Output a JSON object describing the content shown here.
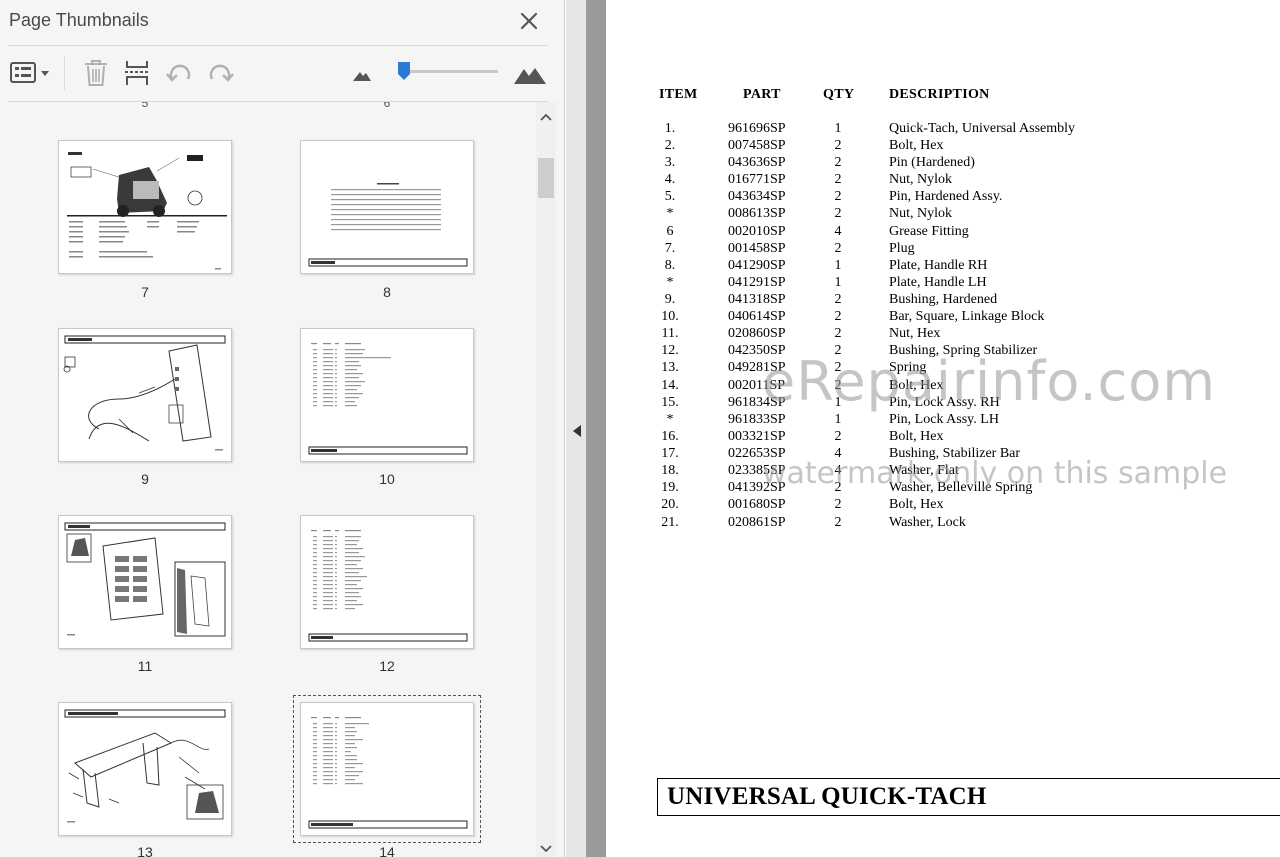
{
  "panel": {
    "title": "Page Thumbnails",
    "toolbar": {
      "icons": [
        "options-menu-icon",
        "trash-icon",
        "extract-pages-icon",
        "rotate-counterclockwise-icon",
        "rotate-clockwise-icon",
        "small-mountain-icon",
        "large-mountain-icon"
      ],
      "thumbnail_size_level": 0.05
    },
    "partial_labels": [
      "5",
      "6"
    ],
    "thumbnails": [
      {
        "page": "7"
      },
      {
        "page": "8"
      },
      {
        "page": "9"
      },
      {
        "page": "10"
      },
      {
        "page": "11"
      },
      {
        "page": "12"
      },
      {
        "page": "13"
      },
      {
        "page": "14",
        "selected": true
      }
    ]
  },
  "document": {
    "headers": {
      "item": "ITEM",
      "part": "PART",
      "qty": "QTY",
      "description": "DESCRIPTION"
    },
    "rows": [
      {
        "item": "1.",
        "part": "961696SP",
        "qty": "1",
        "desc": "Quick-Tach, Universal Assembly"
      },
      {
        "item": "2.",
        "part": "007458SP",
        "qty": "2",
        "desc": "Bolt, Hex"
      },
      {
        "item": "3.",
        "part": "043636SP",
        "qty": "2",
        "desc": "Pin (Hardened)"
      },
      {
        "item": "4.",
        "part": "016771SP",
        "qty": "2",
        "desc": "Nut, Nylok"
      },
      {
        "item": "5.",
        "part": "043634SP",
        "qty": "2",
        "desc": "Pin, Hardened Assy."
      },
      {
        "item": "*",
        "part": "008613SP",
        "qty": "2",
        "desc": "Nut, Nylok"
      },
      {
        "item": "6",
        "part": "002010SP",
        "qty": "4",
        "desc": "Grease Fitting"
      },
      {
        "item": "7.",
        "part": "001458SP",
        "qty": "2",
        "desc": "Plug"
      },
      {
        "item": "8.",
        "part": "041290SP",
        "qty": "1",
        "desc": "Plate, Handle RH"
      },
      {
        "item": "*",
        "part": "041291SP",
        "qty": "1",
        "desc": "Plate, Handle LH"
      },
      {
        "item": "9.",
        "part": "041318SP",
        "qty": "2",
        "desc": "Bushing, Hardened"
      },
      {
        "item": "10.",
        "part": "040614SP",
        "qty": "2",
        "desc": "Bar, Square, Linkage Block"
      },
      {
        "item": "11.",
        "part": "020860SP",
        "qty": "2",
        "desc": "Nut, Hex"
      },
      {
        "item": "12.",
        "part": "042350SP",
        "qty": "2",
        "desc": "Bushing, Spring Stabilizer"
      },
      {
        "item": "13.",
        "part": "049281SP",
        "qty": "2",
        "desc": "Spring"
      },
      {
        "item": "14.",
        "part": "002011SP",
        "qty": "2",
        "desc": "Bolt, Hex"
      },
      {
        "item": "15.",
        "part": "961834SP",
        "qty": "1",
        "desc": "Pin, Lock Assy. RH"
      },
      {
        "item": "*",
        "part": "961833SP",
        "qty": "1",
        "desc": "Pin, Lock Assy. LH"
      },
      {
        "item": "16.",
        "part": "003321SP",
        "qty": "2",
        "desc": "Bolt, Hex"
      },
      {
        "item": "17.",
        "part": "022653SP",
        "qty": "4",
        "desc": "Bushing, Stabilizer Bar"
      },
      {
        "item": "18.",
        "part": "023385SP",
        "qty": "4",
        "desc": "Washer, Flat"
      },
      {
        "item": "19.",
        "part": "041392SP",
        "qty": "2",
        "desc": "Washer, Belleville Spring"
      },
      {
        "item": "20.",
        "part": "001680SP",
        "qty": "2",
        "desc": "Bolt, Hex"
      },
      {
        "item": "21.",
        "part": "020861SP",
        "qty": "2",
        "desc": "Washer, Lock"
      }
    ],
    "watermark": {
      "line1": "eRepairinfo.com",
      "line2": "watermark only on this sample"
    },
    "section_title": "UNIVERSAL QUICK-TACH"
  }
}
